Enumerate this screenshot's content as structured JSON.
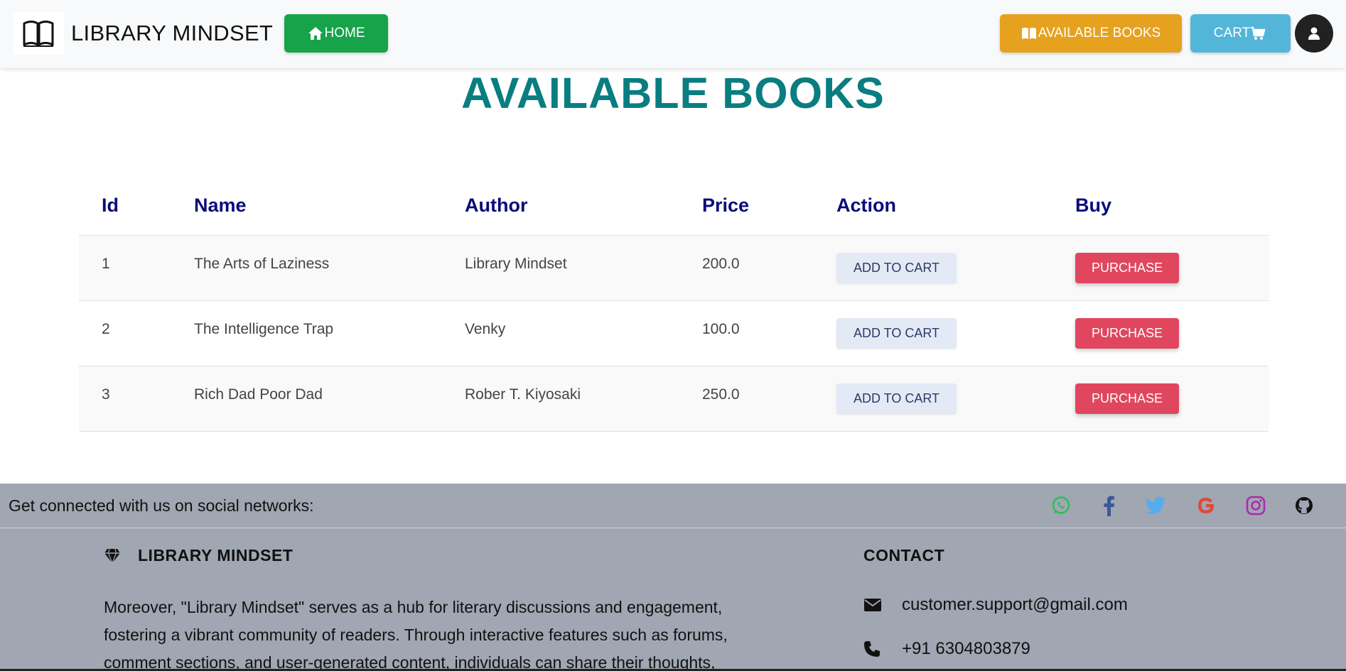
{
  "navbar": {
    "brand": "LIBRARY MINDSET",
    "home_label": "HOME",
    "books_label": "AVAILABLE BOOKS",
    "cart_label": "CART"
  },
  "page": {
    "title": "AVAILABLE BOOKS"
  },
  "table": {
    "headers": [
      "Id",
      "Name",
      "Author",
      "Price",
      "Action",
      "Buy"
    ],
    "rows": [
      {
        "id": "1",
        "name": "The Arts of Laziness",
        "author": "Library Mindset",
        "price": "200.0",
        "action": "ADD TO CART",
        "buy": "PURCHASE"
      },
      {
        "id": "2",
        "name": "The Intelligence Trap",
        "author": "Venky",
        "price": "100.0",
        "action": "ADD TO CART",
        "buy": "PURCHASE"
      },
      {
        "id": "3",
        "name": "Rich Dad Poor Dad",
        "author": "Rober T. Kiyosaki",
        "price": "250.0",
        "action": "ADD TO CART",
        "buy": "PURCHASE"
      }
    ]
  },
  "footer": {
    "social_text": "Get connected with us on social networks:",
    "social_icons": [
      "whatsapp-icon",
      "facebook-icon",
      "twitter-icon",
      "google-icon",
      "instagram-icon",
      "github-icon"
    ],
    "brand": "LIBRARY MINDSET",
    "description": "Moreover, \"Library Mindset\" serves as a hub for literary discussions and engagement, fostering a vibrant community of readers. Through interactive features such as forums, comment sections, and user-generated content, individuals can share their thoughts,",
    "contact_title": "CONTACT",
    "email": "customer.support@gmail.com",
    "phone": "+91 6304803879"
  },
  "colors": {
    "home": "#16a34a",
    "books": "#e6a11e",
    "cart": "#53b6d8",
    "title": "#0a7d80",
    "header_text": "#0b0b7a",
    "purchase": "#e0475f",
    "footer": "#a0a6b2"
  }
}
